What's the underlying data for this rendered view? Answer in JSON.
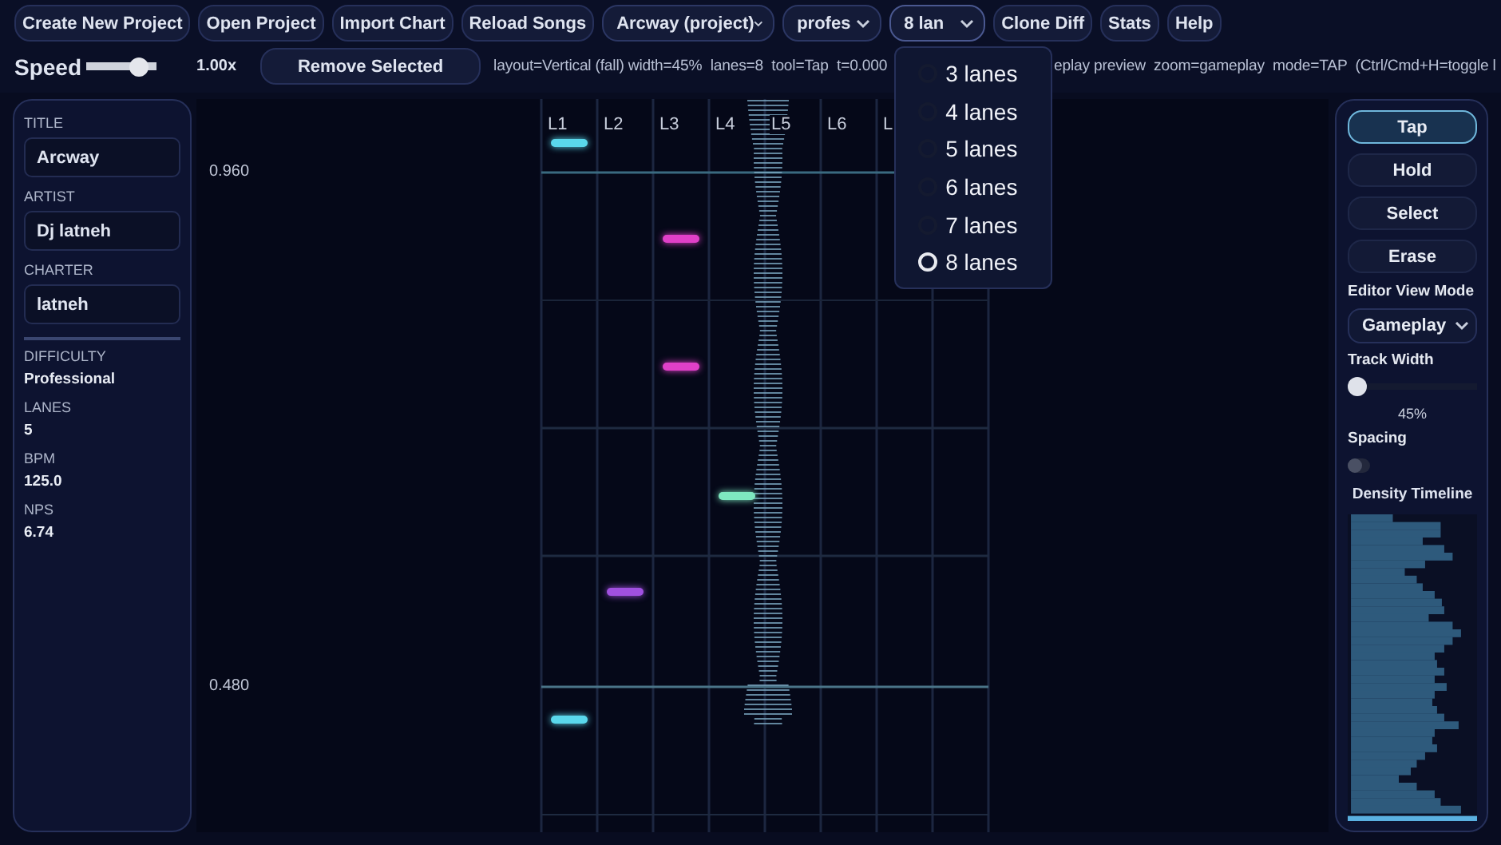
{
  "toolbar": {
    "buttons": [
      "Create New Project",
      "Open Project",
      "Import Chart",
      "Reload Songs"
    ],
    "selects": [
      {
        "value": "Arcway (project)"
      },
      {
        "value": "profes"
      },
      {
        "value": "8 lan",
        "open": true
      }
    ],
    "buttons_after": [
      "Clone Diff",
      "Stats",
      "Help"
    ]
  },
  "lanes_menu": [
    {
      "label": "3 lanes",
      "selected": false
    },
    {
      "label": "4 lanes",
      "selected": false
    },
    {
      "label": "5 lanes",
      "selected": false
    },
    {
      "label": "6 lanes",
      "selected": false
    },
    {
      "label": "7 lanes",
      "selected": false
    },
    {
      "label": "8 lanes",
      "selected": true
    }
  ],
  "speed": {
    "label": "Speed",
    "level": 0.85,
    "reading": "1.00x"
  },
  "remove_button": "Remove Selected",
  "status": [
    "layout=Vertical (fall) width=45%  lanes=8  tool=Tap  t=0.000",
    "eplay preview  zoom=gameplay  mode=TAP  (Ctrl/Cmd+H=toggle l"
  ],
  "meta_fields": [
    {
      "label": "TITLE",
      "value": "Arcway"
    },
    {
      "label": "ARTIST",
      "value": "Dj latneh"
    },
    {
      "label": "CHARTER",
      "value": "latneh"
    }
  ],
  "stats": [
    {
      "label": "DIFFICULTY",
      "value": "Professional"
    },
    {
      "label": "LANES",
      "value": "5"
    },
    {
      "label": "BPM",
      "value": "125.0"
    },
    {
      "label": "NPS",
      "value": "6.74"
    }
  ],
  "canvas": {
    "time_labels": [
      "0.960",
      "0.480"
    ],
    "lane_labels": [
      "L1",
      "L2",
      "L3",
      "L4",
      "L5",
      "L6",
      "L"
    ],
    "notes": [
      {
        "color": "#5ad8ec"
      },
      {
        "color": "#e040c8"
      },
      {
        "color": "#e040c8"
      },
      {
        "color": "#7ee8c0"
      },
      {
        "color": "#a050e0"
      },
      {
        "color": "#5ad8ec"
      }
    ]
  },
  "tools": [
    {
      "label": "Tap",
      "selected": true
    },
    {
      "label": "Hold",
      "selected": false
    },
    {
      "label": "Select",
      "selected": false
    },
    {
      "label": "Erase",
      "selected": false
    }
  ],
  "view_mode": {
    "label": "Editor View Mode",
    "value": "Gameplay"
  },
  "track_width": {
    "label": "Track Width",
    "level": 0.0,
    "reading": "45%"
  },
  "spacing": {
    "label": "Spacing",
    "on": false
  },
  "density": {
    "title": "Density Timeline"
  }
}
